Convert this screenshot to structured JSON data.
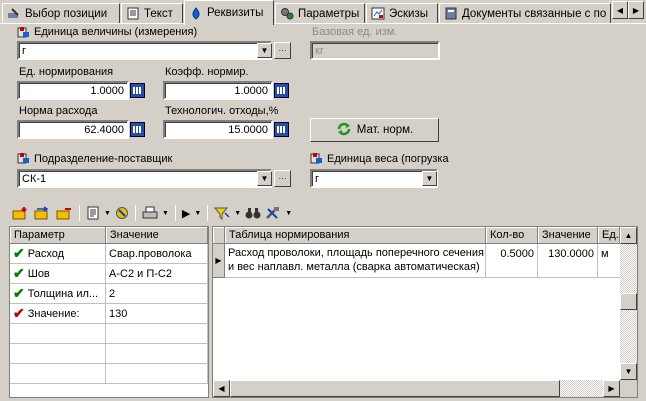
{
  "tabs": [
    {
      "label": "Выбор позиции",
      "icon": "tool-icon"
    },
    {
      "label": "Текст",
      "icon": "document-icon"
    },
    {
      "label": "Реквизиты",
      "icon": "drop-icon"
    },
    {
      "label": "Параметры",
      "icon": "gears-icon"
    },
    {
      "label": "Эскизы",
      "icon": "sketch-icon"
    },
    {
      "label": "Документы связанные с по",
      "icon": "book-icon"
    }
  ],
  "form": {
    "unit_label": "Единица величины (измерения)",
    "unit_value": "г",
    "base_unit_label": "Базовая ед. изм.",
    "base_unit_value": "кг",
    "norm_unit_label": "Ед. нормирования",
    "norm_unit_value": "1.0000",
    "coef_label": "Коэфф. нормир.",
    "coef_value": "1.0000",
    "consumption_label": "Норма расхода",
    "consumption_value": "62.4000",
    "waste_label": "Технологич. отходы,%",
    "waste_value": "15.0000",
    "mat_norm_button": "Мат. норм.",
    "supplier_label": "Подразделение-поставщик",
    "supplier_value": "СК-1",
    "weight_unit_label": "Единица веса (погрузка",
    "weight_unit_value": "г",
    "ellipsis": "···"
  },
  "params_table": {
    "headers": [
      "Параметр",
      "Значение"
    ],
    "rows": [
      {
        "param": "Расход",
        "value": "Свар.проволока"
      },
      {
        "param": "Шов",
        "value": "А-С2 и П-С2"
      },
      {
        "param": "Толщина ил...",
        "value": "2"
      },
      {
        "param": "Значение:",
        "value": "130"
      }
    ]
  },
  "norm_table": {
    "headers": [
      "Таблица нормирования",
      "Кол-во",
      "Значение",
      "Ед."
    ],
    "rows": [
      {
        "desc_line1": "Расход проволоки, площадь поперечного сечения",
        "desc_line2": "и вес наплавл. металла (сварка автоматическая)",
        "qty": "0.5000",
        "value": "130.0000",
        "unit": "м"
      }
    ]
  },
  "colors": {
    "window": "#d4d0c8",
    "check_green": "#008000",
    "check_red": "#c00000",
    "calc_blue": "#2a4fa0"
  }
}
